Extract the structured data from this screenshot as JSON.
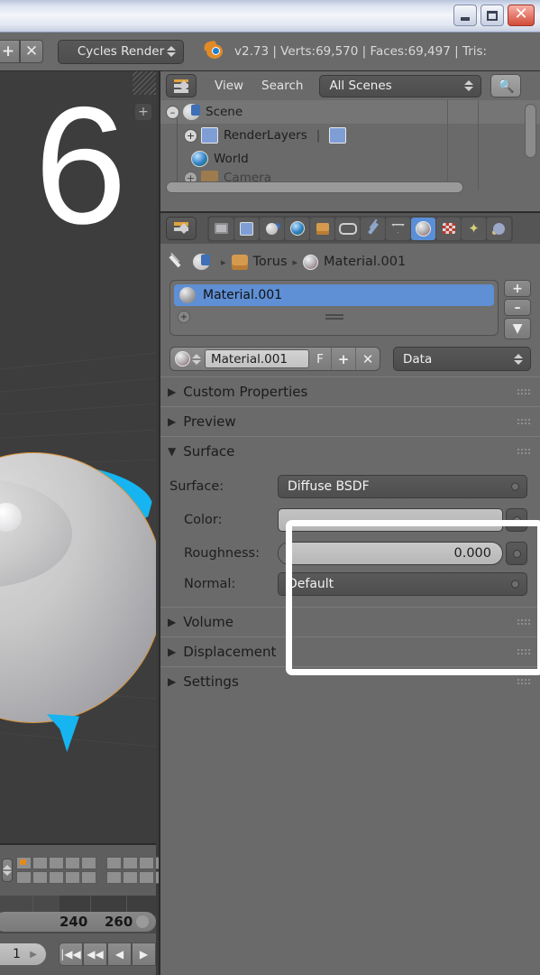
{
  "window": {
    "minimize_label": "–",
    "maximize_label": "□",
    "close_label": "✕"
  },
  "top_header": {
    "add_button_label": "+",
    "close_button_label": "✕",
    "render_engine": "Cycles Render",
    "stats": "v2.73 | Verts:69,570 | Faces:69,497 | Tris:",
    "blender_logo_name": "blender-logo"
  },
  "viewport": {
    "overlay_number": "6",
    "add_overlay_button": "+"
  },
  "outliner": {
    "editor_type": "outliner-editor-icon",
    "menus": [
      "View",
      "Search"
    ],
    "view_label": "View",
    "search_label": "Search",
    "display_mode": "All Scenes",
    "search_icon": "magnifier-icon",
    "rows": [
      {
        "label": "Scene",
        "indent": 0,
        "expander": "–",
        "icon": "scene-icon",
        "selected": true
      },
      {
        "label": "RenderLayers",
        "indent": 1,
        "expander": "+",
        "icon": "renderlayer-icon",
        "selected": false
      },
      {
        "label": "World",
        "indent": 2,
        "expander": "",
        "icon": "world-icon",
        "selected": false
      },
      {
        "label": "Camera",
        "indent": 2,
        "expander": "+",
        "icon": "camera-icon",
        "selected": false
      }
    ]
  },
  "properties": {
    "tabs": [
      {
        "name": "render",
        "active": false
      },
      {
        "name": "render-layers",
        "active": false
      },
      {
        "name": "scene",
        "active": false
      },
      {
        "name": "world",
        "active": false
      },
      {
        "name": "object",
        "active": false
      },
      {
        "name": "constraints",
        "active": false
      },
      {
        "name": "modifiers",
        "active": false
      },
      {
        "name": "data",
        "active": false
      },
      {
        "name": "material",
        "active": true
      },
      {
        "name": "texture",
        "active": false
      },
      {
        "name": "particles",
        "active": false
      },
      {
        "name": "physics",
        "active": false
      }
    ],
    "breadcrumb": {
      "object": "Torus",
      "material": "Material.001",
      "separator": "▸"
    },
    "material_slots": {
      "selected_slot": "Material.001",
      "add_slot_label": "+",
      "remove_slot_label": "–",
      "menu_label": "▼"
    },
    "id_block": {
      "name_value": "Material.001",
      "fake_user_label": "F",
      "new_label": "+",
      "unlink_label": "✕",
      "data_dropdown": "Data"
    },
    "panels": [
      {
        "title": "Custom Properties",
        "open": false
      },
      {
        "title": "Preview",
        "open": false
      },
      {
        "title": "Surface",
        "open": true
      },
      {
        "title": "Volume",
        "open": false
      },
      {
        "title": "Displacement",
        "open": false
      },
      {
        "title": "Settings",
        "open": false
      }
    ],
    "surface": {
      "surface_label": "Surface:",
      "surface_value": "Diffuse BSDF",
      "color_label": "Color:",
      "color_value_hex": "#bcbcbc",
      "roughness_label": "Roughness:",
      "roughness_value": "0.000",
      "normal_label": "Normal:",
      "normal_value": "Default"
    }
  },
  "timeline": {
    "frame_current": "1",
    "tick_labels": [
      "240",
      "260"
    ],
    "jump_start_label": "|◀◀",
    "prev_key_label": "◀◀",
    "play_reverse_label": "◀",
    "play_label": "▶"
  },
  "colors": {
    "accent_blue": "#5f8fd4",
    "highlight_white": "#ffffff",
    "select_orange": "#d8933a",
    "cyan": "#16b4f0",
    "panel_gray": "#6a6a6a"
  }
}
